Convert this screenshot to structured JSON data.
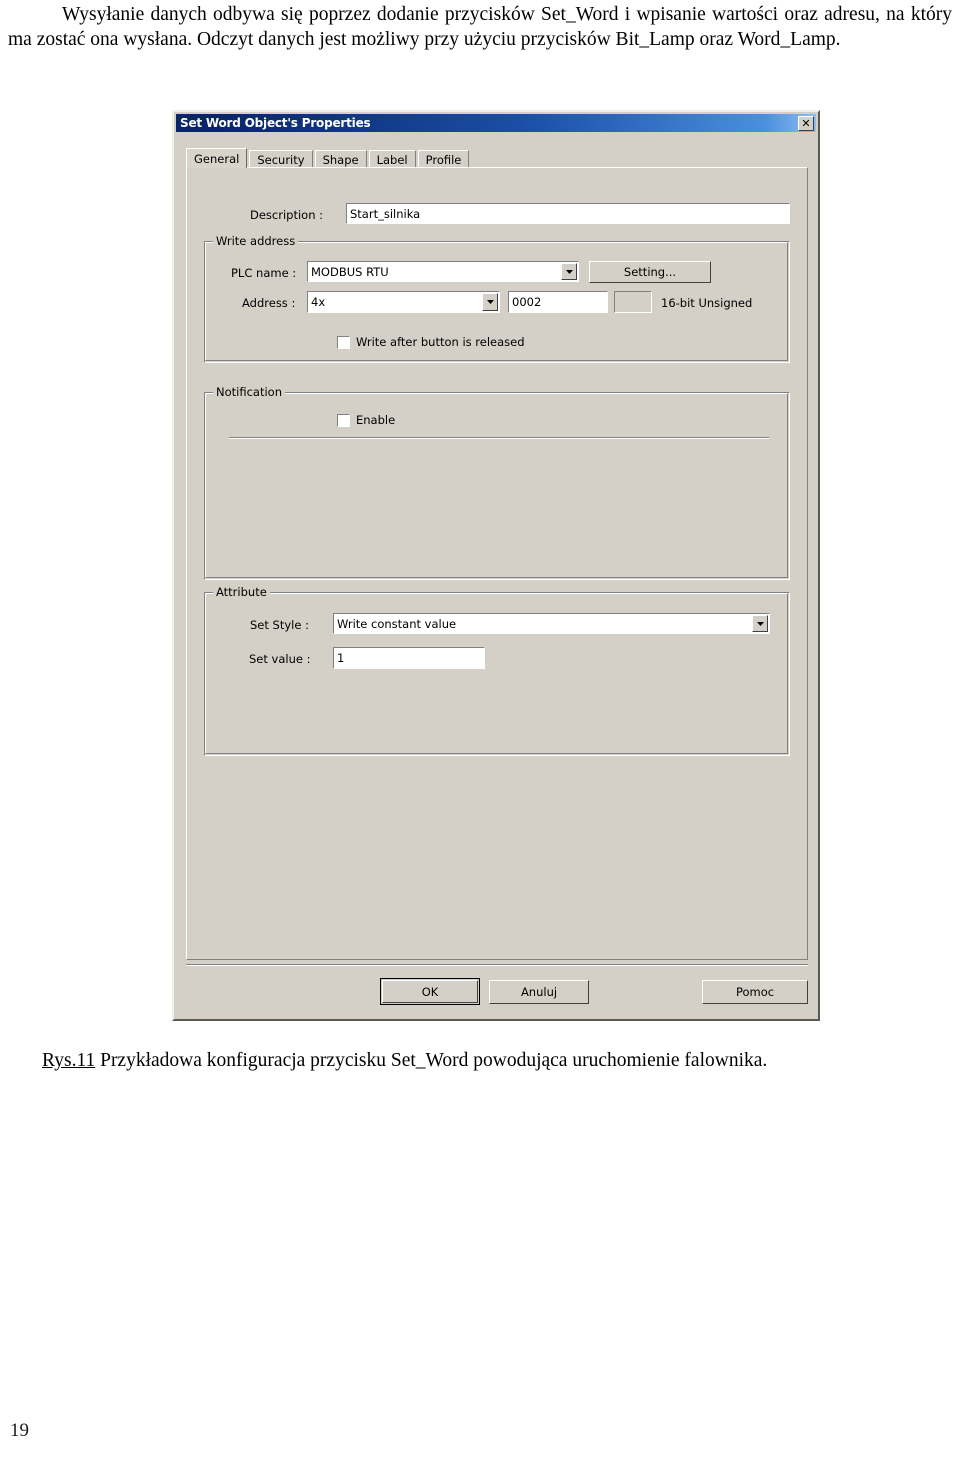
{
  "document": {
    "paragraph": "Wysyłanie danych odbywa się poprzez dodanie przycisków Set_Word i wpisanie wartości oraz adresu, na który ma zostać ona wysłana. Odczyt danych jest możliwy przy użyciu przycisków Bit_Lamp oraz Word_Lamp.",
    "caption_link": "Rys.11",
    "caption_text": " Przykładowa konfiguracja przycisku Set_Word powodująca uruchomienie falownika.",
    "page_number": "19"
  },
  "dialog": {
    "title": "Set Word Object's Properties",
    "close_label": "✕",
    "tabs": [
      {
        "label": "General",
        "active": true
      },
      {
        "label": "Security",
        "active": false
      },
      {
        "label": "Shape",
        "active": false
      },
      {
        "label": "Label",
        "active": false
      },
      {
        "label": "Profile",
        "active": false
      }
    ],
    "description": {
      "label": "Description :",
      "value": "Start_silnika"
    },
    "write_address": {
      "group_title": "Write address",
      "plc_name_label": "PLC name :",
      "plc_name_value": "MODBUS RTU",
      "setting_button": "Setting...",
      "address_label": "Address :",
      "address_type_value": "4x",
      "address_value": "0002",
      "address_spare_value": "",
      "data_format": "16-bit Unsigned",
      "write_after_release_label": "Write after button is released",
      "write_after_release_checked": false
    },
    "notification": {
      "group_title": "Notification",
      "enable_label": "Enable",
      "enable_checked": false
    },
    "attribute": {
      "group_title": "Attribute",
      "set_style_label": "Set Style :",
      "set_style_value": "Write constant value",
      "set_value_label": "Set value :",
      "set_value": "1"
    },
    "buttons": {
      "ok": "OK",
      "cancel": "Anuluj",
      "help": "Pomoc"
    },
    "colors": {
      "face": "#d4d0c8",
      "titlebar_start": "#0a246a",
      "titlebar_end": "#8fbdf0",
      "field_bg": "#ffffff"
    }
  }
}
